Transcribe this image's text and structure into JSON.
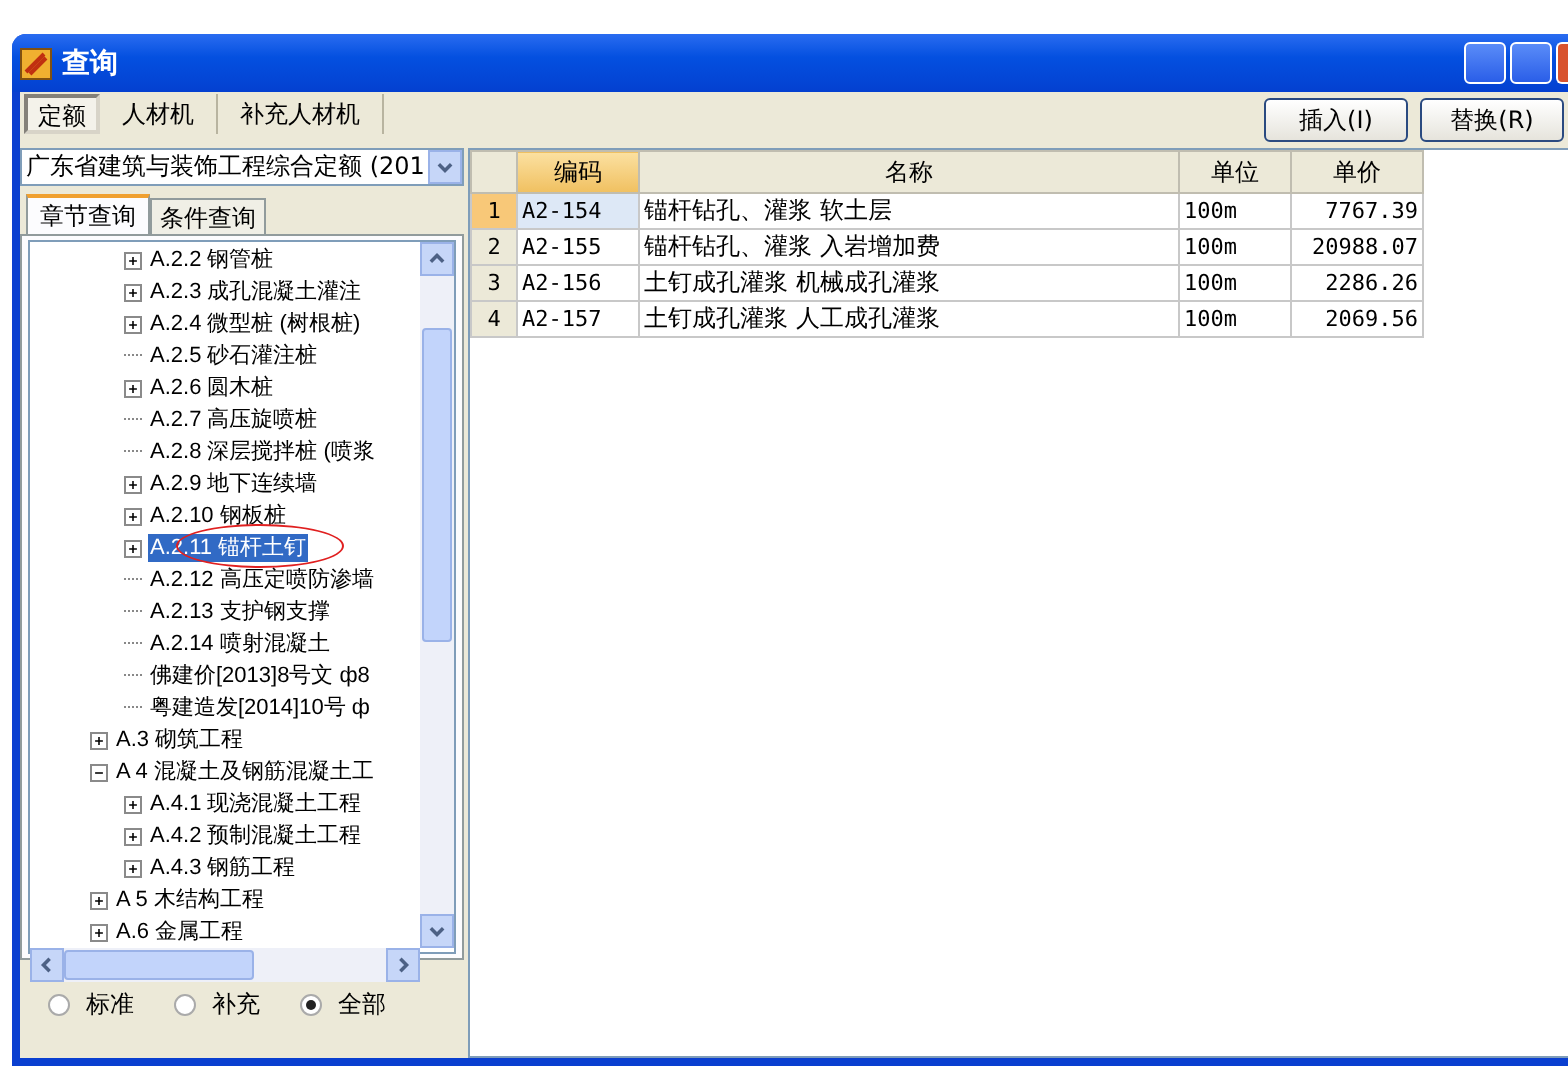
{
  "window": {
    "title": "查询"
  },
  "tabs": [
    {
      "label": "定额",
      "selected": true
    },
    {
      "label": "人材机",
      "selected": false
    },
    {
      "label": "补充人材机",
      "selected": false
    }
  ],
  "buttons": [
    "插入(I)",
    "替换(R)"
  ],
  "left_panel": {
    "dropdown": {
      "value": "广东省建筑与装饰工程综合定额 (201"
    },
    "subtabs": [
      {
        "label": "章节查询",
        "selected": true
      },
      {
        "label": "条件查询",
        "selected": false
      }
    ],
    "tree": {
      "continued_children": [
        {
          "label": "A.2.2 钢管桩",
          "has_children": true,
          "expanded": false,
          "selected": false
        },
        {
          "label": "A.2.3 成孔混凝土灌注",
          "has_children": true,
          "expanded": false,
          "selected": false
        },
        {
          "label": "A.2.4 微型桩 (树根桩)",
          "has_children": true,
          "expanded": false,
          "selected": false
        },
        {
          "label": "A.2.5 砂石灌注桩",
          "has_children": false,
          "selected": false
        },
        {
          "label": "A.2.6 圆木桩",
          "has_children": true,
          "expanded": false,
          "selected": false
        },
        {
          "label": "A.2.7 高压旋喷桩",
          "has_children": false,
          "selected": false
        },
        {
          "label": "A.2.8 深层搅拌桩 (喷浆",
          "has_children": false,
          "selected": false
        },
        {
          "label": "A.2.9 地下连续墙",
          "has_children": true,
          "expanded": false,
          "selected": false
        },
        {
          "label": "A.2.10 钢板桩",
          "has_children": true,
          "expanded": false,
          "selected": false
        },
        {
          "label": "A.2.11 锚杆土钉",
          "has_children": true,
          "expanded": false,
          "selected": true,
          "circled": true
        },
        {
          "label": "A.2.12 高压定喷防渗墙",
          "has_children": false,
          "selected": false
        },
        {
          "label": "A.2.13 支护钢支撑",
          "has_children": false,
          "selected": false
        },
        {
          "label": "A.2.14 喷射混凝土",
          "has_children": false,
          "selected": false
        },
        {
          "label": "佛建价[2013]8号文 ф8",
          "has_children": false,
          "selected": false
        },
        {
          "label": "粤建造发[2014]10号 ф",
          "has_children": false,
          "selected": false
        }
      ],
      "items": [
        {
          "label": "A.3 砌筑工程",
          "has_children": true,
          "expanded": false,
          "selected": false
        },
        {
          "label": "A 4 混凝土及钢筋混凝土工",
          "has_children": true,
          "expanded": true,
          "selected": false,
          "children": [
            {
              "label": "A.4.1 现浇混凝土工程",
              "has_children": true,
              "expanded": false,
              "selected": false
            },
            {
              "label": "A.4.2 预制混凝土工程",
              "has_children": true,
              "expanded": false,
              "selected": false
            },
            {
              "label": "A.4.3 钢筋工程",
              "has_children": true,
              "expanded": false,
              "selected": false
            }
          ]
        },
        {
          "label": "A 5 木结构工程",
          "has_children": true,
          "expanded": false,
          "selected": false
        },
        {
          "label": "A.6 金属工程",
          "has_children": true,
          "expanded": false,
          "selected": false
        }
      ]
    },
    "radios": [
      {
        "label": "标准",
        "selected": false
      },
      {
        "label": "补充",
        "selected": false
      },
      {
        "label": "全部",
        "selected": true
      }
    ]
  },
  "table": {
    "columns": [
      {
        "label": "编码",
        "selected": true
      },
      {
        "label": "名称",
        "selected": false
      },
      {
        "label": "单位",
        "selected": false
      },
      {
        "label": "单价",
        "selected": false
      }
    ],
    "rows": [
      {
        "index": "1",
        "selected": true,
        "cells": [
          "A2-154",
          "锚杆钻孔、灌浆 软土层",
          "100m",
          "7767.39"
        ]
      },
      {
        "index": "2",
        "selected": false,
        "cells": [
          "A2-155",
          "锚杆钻孔、灌浆 入岩增加费",
          "100m",
          "20988.07"
        ]
      },
      {
        "index": "3",
        "selected": false,
        "cells": [
          "A2-156",
          "土钉成孔灌浆 机械成孔灌浆",
          "100m",
          "2286.26"
        ]
      },
      {
        "index": "4",
        "selected": false,
        "cells": [
          "A2-157",
          "土钉成孔灌浆 人工成孔灌浆",
          "100m",
          "2069.56"
        ]
      }
    ]
  }
}
